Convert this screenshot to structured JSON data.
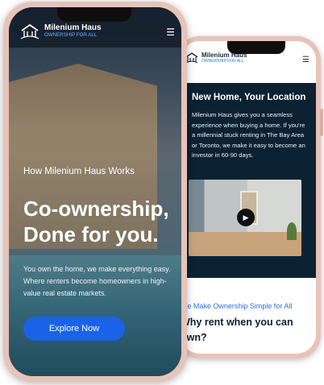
{
  "brand": {
    "name": "Milenium Haus",
    "tagline": "OWNERSHIP FOR ALL"
  },
  "front_screen": {
    "subtitle": "How Milenium Haus Works",
    "headline_line1": "Co-ownership,",
    "headline_line2": "Done for you.",
    "body": "You own the home, we make everything easy. Where renters become homeowners in high-value real estate markets.",
    "cta_label": "Explore Now"
  },
  "back_screen": {
    "section_title": "New Home, Your Location",
    "section_body": "Milenium Haus gives you a seamless experience when buying a home. If you're a millennial stuck renting in The Bay Area or Toronto, we make it easy to become an investor in 60-90 days.",
    "tagline": "We Make Ownership Simple for All",
    "heading": "Why rent when you can own?"
  },
  "icons": {
    "menu": "hamburger-icon",
    "play": "play-icon",
    "logo": "house-logo-icon"
  },
  "colors": {
    "accent": "#1a63e8",
    "dark_panel": "#0c2233",
    "phone_frame": "#e7c3b8",
    "link_blue": "#2c6fe0"
  }
}
